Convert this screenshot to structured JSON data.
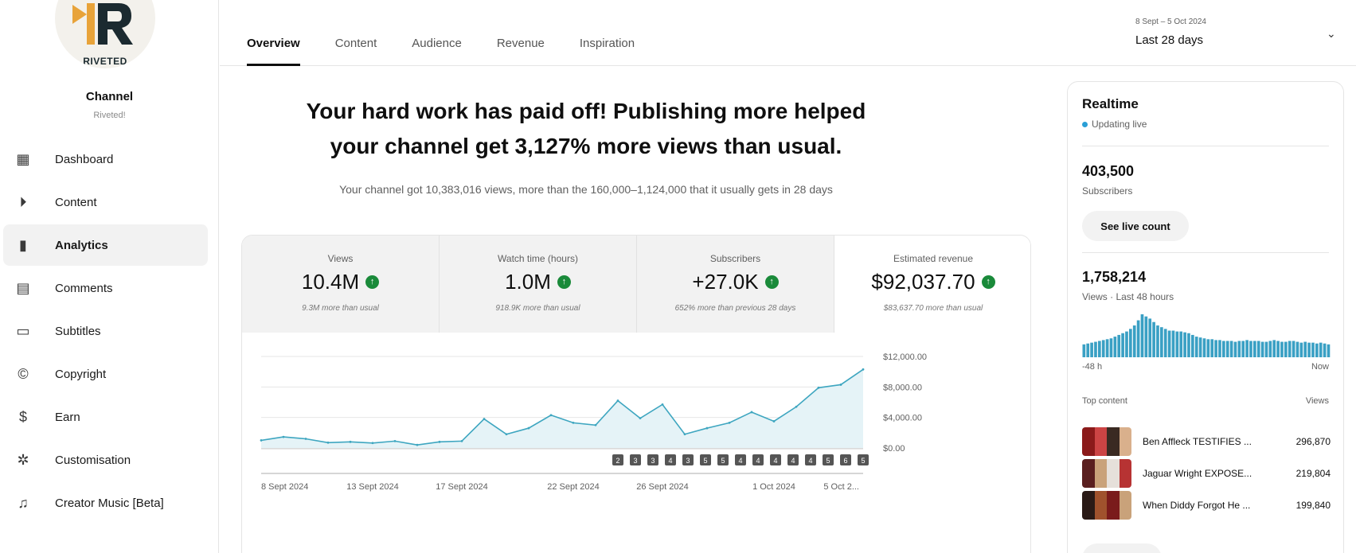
{
  "brand": {
    "logo_text": "RIVETED",
    "accent": "#e8a33a",
    "dark": "#1b2a30"
  },
  "channel": {
    "title": "Channel",
    "name": "Riveted!"
  },
  "sidebar": {
    "items": [
      {
        "label": "Dashboard",
        "icon": "dashboard-icon",
        "glyph": "▦"
      },
      {
        "label": "Content",
        "icon": "content-icon",
        "glyph": "⏵"
      },
      {
        "label": "Analytics",
        "icon": "analytics-icon",
        "glyph": "▮",
        "active": true
      },
      {
        "label": "Comments",
        "icon": "comments-icon",
        "glyph": "▤"
      },
      {
        "label": "Subtitles",
        "icon": "subtitles-icon",
        "glyph": "▭"
      },
      {
        "label": "Copyright",
        "icon": "copyright-icon",
        "glyph": "©"
      },
      {
        "label": "Earn",
        "icon": "dollar-icon",
        "glyph": "$"
      },
      {
        "label": "Customisation",
        "icon": "magic-wand-icon",
        "glyph": "✲"
      },
      {
        "label": "Creator Music [Beta]",
        "icon": "music-icon",
        "glyph": "♫"
      }
    ]
  },
  "tabs": [
    "Overview",
    "Content",
    "Audience",
    "Revenue",
    "Inspiration"
  ],
  "date_range": {
    "range": "8 Sept – 5 Oct 2024",
    "label": "Last 28 days"
  },
  "hero": {
    "title": "Your hard work has paid off! Publishing more helped your channel get 3,127% more views than usual.",
    "subtitle": "Your channel got 10,383,016 views, more than the 160,000–1,124,000 that it usually gets in 28 days"
  },
  "metrics": [
    {
      "label": "Views",
      "value": "10.4M",
      "note": "9.3M more than usual"
    },
    {
      "label": "Watch time (hours)",
      "value": "1.0M",
      "note": "918.9K more than usual"
    },
    {
      "label": "Subscribers",
      "value": "+27.0K",
      "note": "652% more than previous 28 days"
    },
    {
      "label": "Estimated revenue",
      "value": "$92,037.70",
      "note": "$83,637.70 more than usual",
      "active": true
    }
  ],
  "chart_data": {
    "type": "area",
    "x": [
      "8 Sept",
      "9 Sept",
      "10 Sept",
      "11 Sept",
      "12 Sept",
      "13 Sept",
      "14 Sept",
      "15 Sept",
      "16 Sept",
      "17 Sept",
      "18 Sept",
      "19 Sept",
      "20 Sept",
      "21 Sept",
      "22 Sept",
      "23 Sept",
      "24 Sept",
      "25 Sept",
      "26 Sept",
      "27 Sept",
      "28 Sept",
      "29 Sept",
      "30 Sept",
      "1 Oct",
      "2 Oct",
      "3 Oct",
      "4 Oct",
      "5 Oct"
    ],
    "series": [
      {
        "values": [
          1000,
          1450,
          1200,
          700,
          800,
          650,
          900,
          400,
          800,
          900,
          3800,
          1800,
          2600,
          4300,
          3300,
          3000,
          6200,
          3900,
          5700,
          1800,
          2600,
          3300,
          4700,
          3500,
          5400,
          7900,
          8300,
          10300
        ]
      }
    ],
    "y_ticks": [
      "$12,000.00",
      "$8,000.00",
      "$4,000.00",
      "$0.00"
    ],
    "ylim": [
      0,
      12000
    ],
    "x_tick_labels": [
      "8 Sept 2024",
      "13 Sept 2024",
      "17 Sept 2024",
      "22 Sept 2024",
      "26 Sept 2024",
      "1 Oct 2024",
      "5 Oct 2..."
    ],
    "markers": [
      "2",
      "3",
      "3",
      "4",
      "3",
      "5",
      "5",
      "4",
      "4",
      "4",
      "4",
      "4",
      "5",
      "6",
      "5"
    ],
    "grid": true,
    "color": "#3ea6c0"
  },
  "realtime": {
    "title": "Realtime",
    "live": "Updating live",
    "subscribers": "403,500",
    "subscribers_label": "Subscribers",
    "button": "See live count",
    "views": "1,758,214",
    "views_label": "Views · Last 48 hours",
    "axis_left": "-48 h",
    "axis_right": "Now",
    "bars": [
      30,
      32,
      34,
      36,
      38,
      40,
      42,
      44,
      48,
      52,
      56,
      60,
      66,
      74,
      86,
      100,
      95,
      90,
      82,
      74,
      70,
      66,
      62,
      62,
      60,
      60,
      58,
      56,
      52,
      48,
      46,
      44,
      42,
      42,
      40,
      40,
      38,
      38,
      38,
      36,
      38,
      38,
      40,
      38,
      38,
      38,
      36,
      36,
      38,
      40,
      38,
      36,
      36,
      38,
      38,
      36,
      34,
      36,
      34,
      34,
      32,
      34,
      32,
      30
    ],
    "top_content_label": "Top content",
    "top_views_label": "Views",
    "top_content": [
      {
        "title": "Ben Affleck TESTIFIES ...",
        "views": "296,870"
      },
      {
        "title": "Jaguar Wright EXPOSE...",
        "views": "219,804"
      },
      {
        "title": "When Diddy Forgot He ...",
        "views": "199,840"
      }
    ]
  }
}
